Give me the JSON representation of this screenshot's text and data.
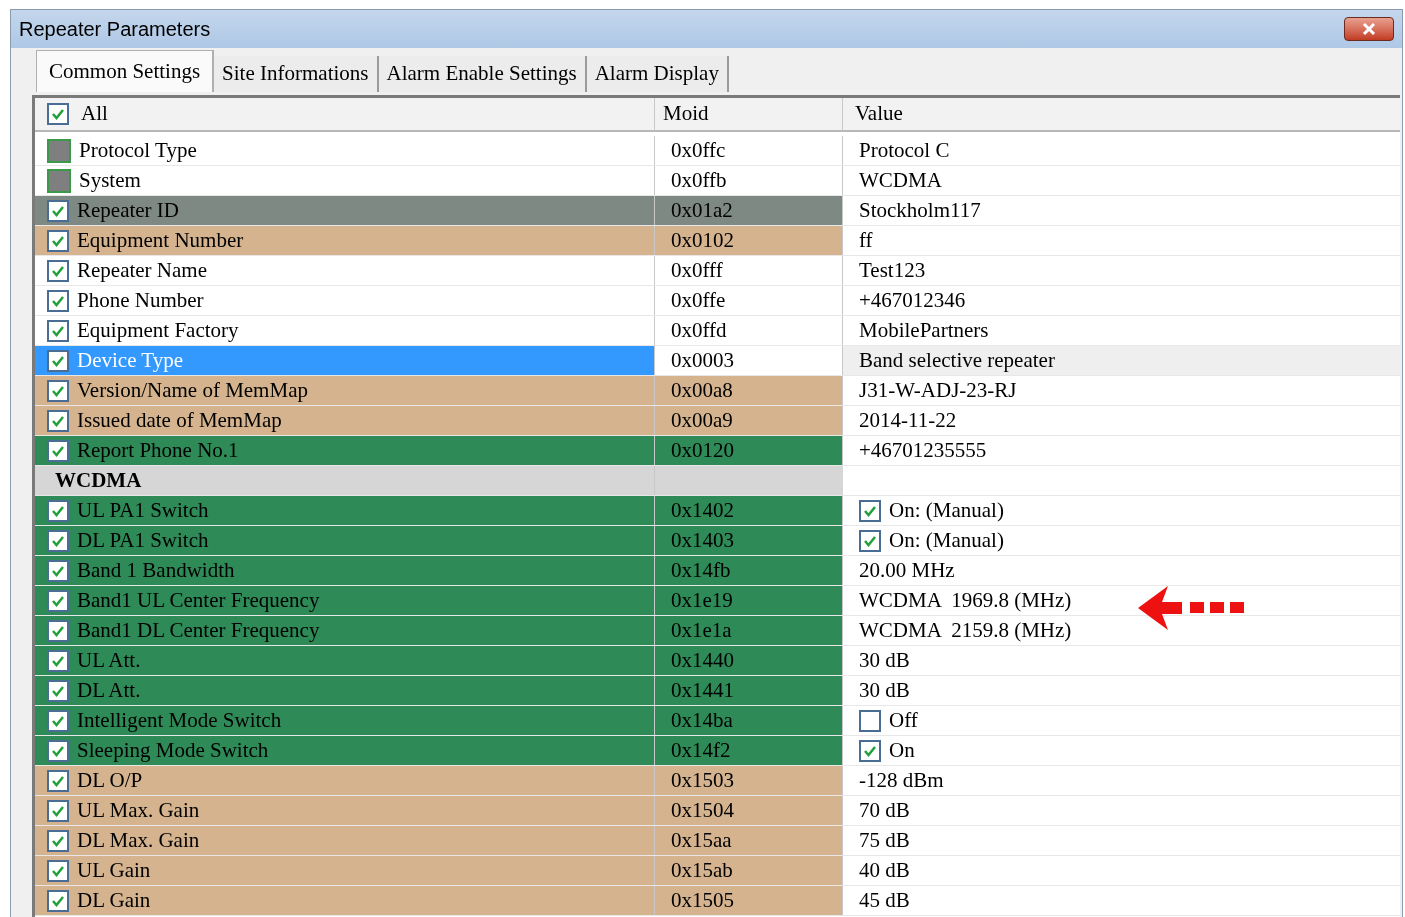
{
  "window": {
    "title": "Repeater Parameters"
  },
  "tabs": [
    {
      "label": "Common Settings",
      "selected": true
    },
    {
      "label": "Site Informations",
      "selected": false
    },
    {
      "label": "Alarm Enable Settings",
      "selected": false
    },
    {
      "label": "Alarm Display",
      "selected": false
    }
  ],
  "table": {
    "columns": [
      "All",
      "Moid",
      "Value"
    ],
    "all_checked": true,
    "rows": [
      {
        "kind": "fixed",
        "name": "Protocol Type",
        "moid": "0x0ffc",
        "value": "Protocol C",
        "color": "#ffffff",
        "selected": false
      },
      {
        "kind": "fixed",
        "name": "System",
        "moid": "0x0ffb",
        "value": "WCDMA",
        "color": "#ffffff",
        "selected": false
      },
      {
        "kind": "check",
        "checked": true,
        "name": "Repeater ID",
        "moid": "0x01a2",
        "value": "Stockholm117",
        "color": "#7f8984",
        "selected": false
      },
      {
        "kind": "check",
        "checked": true,
        "name": "Equipment Number",
        "moid": "0x0102",
        "value": "ff",
        "color": "#d4b38e",
        "selected": false
      },
      {
        "kind": "check",
        "checked": true,
        "name": "Repeater Name",
        "moid": "0x0fff",
        "value": "Test123",
        "color": "#ffffff",
        "selected": false
      },
      {
        "kind": "check",
        "checked": true,
        "name": "Phone Number",
        "moid": "0x0ffe",
        "value": "+467012346",
        "color": "#ffffff",
        "selected": false
      },
      {
        "kind": "check",
        "checked": true,
        "name": "Equipment Factory",
        "moid": "0x0ffd",
        "value": "MobilePartners",
        "color": "#ffffff",
        "selected": false
      },
      {
        "kind": "check",
        "checked": true,
        "name": "Device Type",
        "moid": "0x0003",
        "value": "Band selective repeater",
        "color": "#ffffff",
        "selected": true
      },
      {
        "kind": "check",
        "checked": true,
        "name": "Version/Name of MemMap",
        "moid": "0x00a8",
        "value": "J31-W-ADJ-23-RJ",
        "color": "#d4b38e",
        "selected": false
      },
      {
        "kind": "check",
        "checked": true,
        "name": "Issued date of MemMap",
        "moid": "0x00a9",
        "value": "2014-11-22",
        "color": "#d4b38e",
        "selected": false
      },
      {
        "kind": "check",
        "checked": true,
        "name": "Report Phone No.1",
        "moid": "0x0120",
        "value": "+46701235555",
        "color": "#2e8a57",
        "selected": false
      },
      {
        "kind": "group",
        "name": "WCDMA"
      },
      {
        "kind": "check",
        "checked": true,
        "name": "UL PA1 Switch",
        "moid": "0x1402",
        "value": "On: (Manual)",
        "value_checked": true,
        "color": "#2e8a57",
        "selected": false
      },
      {
        "kind": "check",
        "checked": true,
        "name": "DL PA1 Switch",
        "moid": "0x1403",
        "value": "On: (Manual)",
        "value_checked": true,
        "color": "#2e8a57",
        "selected": false
      },
      {
        "kind": "check",
        "checked": true,
        "name": "Band 1 Bandwidth",
        "moid": "0x14fb",
        "value": "20.00 MHz",
        "color": "#2e8a57",
        "selected": false
      },
      {
        "kind": "check",
        "checked": true,
        "name": "Band1 UL Center Frequency",
        "moid": "0x1e19",
        "value": "WCDMA  1969.8 (MHz)",
        "color": "#2e8a57",
        "selected": false
      },
      {
        "kind": "check",
        "checked": true,
        "name": "Band1 DL Center Frequency",
        "moid": "0x1e1a",
        "value": "WCDMA  2159.8 (MHz)",
        "color": "#2e8a57",
        "selected": false
      },
      {
        "kind": "check",
        "checked": true,
        "name": "UL Att.",
        "moid": "0x1440",
        "value": "30 dB",
        "color": "#2e8a57",
        "selected": false
      },
      {
        "kind": "check",
        "checked": true,
        "name": "DL Att.",
        "moid": "0x1441",
        "value": "30 dB",
        "color": "#2e8a57",
        "selected": false
      },
      {
        "kind": "check",
        "checked": true,
        "name": "Intelligent Mode Switch",
        "moid": "0x14ba",
        "value": "Off",
        "value_checked": false,
        "color": "#2e8a57",
        "selected": false
      },
      {
        "kind": "check",
        "checked": true,
        "name": "Sleeping Mode Switch",
        "moid": "0x14f2",
        "value": "On",
        "value_checked": true,
        "color": "#2e8a57",
        "selected": false
      },
      {
        "kind": "check",
        "checked": true,
        "name": "DL O/P",
        "moid": "0x1503",
        "value": "-128 dBm",
        "color": "#d4b38e",
        "selected": false
      },
      {
        "kind": "check",
        "checked": true,
        "name": "UL Max. Gain",
        "moid": "0x1504",
        "value": "70 dB",
        "color": "#d4b38e",
        "selected": false
      },
      {
        "kind": "check",
        "checked": true,
        "name": "DL Max. Gain",
        "moid": "0x15aa",
        "value": "75 dB",
        "color": "#d4b38e",
        "selected": false
      },
      {
        "kind": "check",
        "checked": true,
        "name": "UL Gain",
        "moid": "0x15ab",
        "value": "40 dB",
        "color": "#d4b38e",
        "selected": false
      },
      {
        "kind": "check",
        "checked": true,
        "name": "DL Gain",
        "moid": "0x1505",
        "value": "45 dB",
        "color": "#d4b38e",
        "selected": false
      }
    ]
  }
}
